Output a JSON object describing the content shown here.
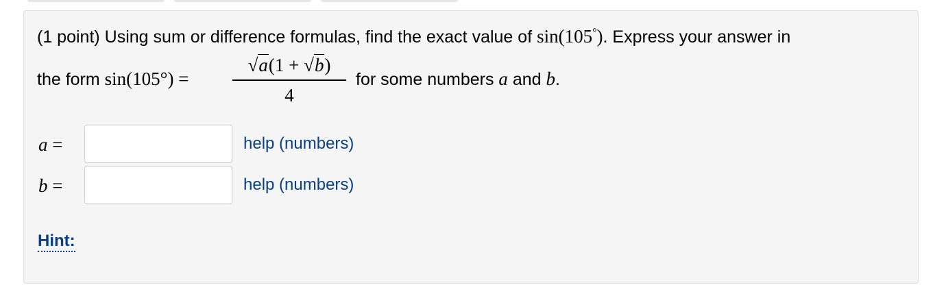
{
  "problem": {
    "points": "(1 point)",
    "prompt_before": "Using sum or difference formulas, find the exact value of",
    "expr_sin": "sin(105",
    "expr_deg": "°",
    "expr_close": ")",
    "prompt_after": ". Express your answer in",
    "line2_start": "the form",
    "lhs": "sin(105°) =",
    "fraction": {
      "sqrt_a": "a",
      "middle": "(1 +",
      "sqrt_b": "b",
      "close": ")",
      "denominator": "4"
    },
    "suffix_text": "for some numbers",
    "var_a": "a",
    "and_text": "and",
    "var_b": "b",
    "period": "."
  },
  "answers": [
    {
      "label": "a",
      "eq": "=",
      "value": "",
      "help": "help (numbers)"
    },
    {
      "label": "b",
      "eq": "=",
      "value": "",
      "help": "help (numbers)"
    }
  ],
  "hint_label": "Hint:"
}
